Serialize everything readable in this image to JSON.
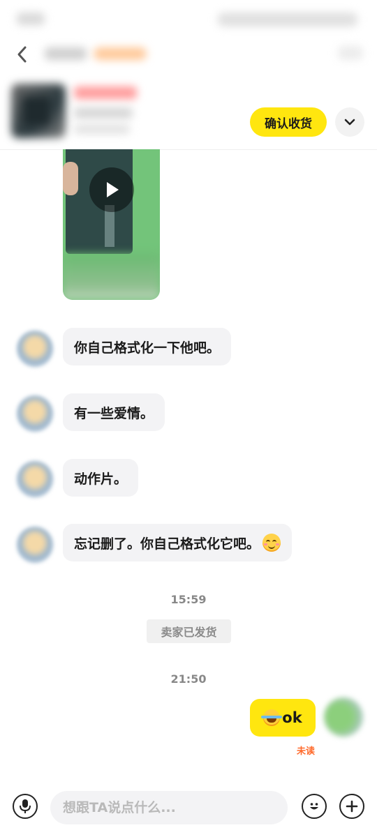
{
  "order": {
    "confirm_label": "确认收货"
  },
  "messages": {
    "incoming": [
      {
        "text": "你自己格式化一下他吧。"
      },
      {
        "text": "有一些爱情。"
      },
      {
        "text": "动作片。"
      },
      {
        "text": "忘记删了。你自己格式化它吧。",
        "emoji": "blushing-smile-emoji"
      }
    ],
    "timestamps": [
      "15:59",
      "21:50"
    ],
    "system_notice": "卖家已发货",
    "outgoing": {
      "text": "ok",
      "emoji": "laughing-tears-emoji",
      "status": "未读"
    }
  },
  "input": {
    "placeholder": "想跟TA说点什么..."
  },
  "colors": {
    "accent": "#ffe60f",
    "unread": "#ff6a2b",
    "bubble_in": "#f3f3f5"
  }
}
